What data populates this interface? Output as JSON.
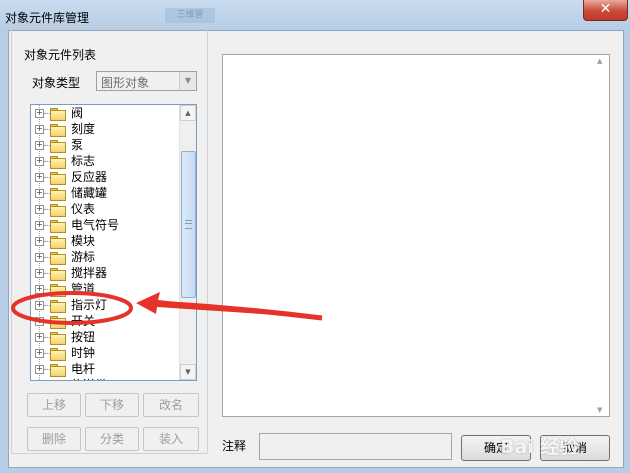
{
  "window": {
    "title": "对象元件库管理",
    "blurred_tab": "三维管",
    "close_glyph": "✕"
  },
  "group": {
    "legend": "对象元件列表"
  },
  "type_selector": {
    "label": "对象类型",
    "value": "图形对象"
  },
  "tree": {
    "items": [
      "阀",
      "刻度",
      "泵",
      "标志",
      "反应器",
      "储藏罐",
      "仪表",
      "电气符号",
      "模块",
      "游标",
      "搅拌器",
      "管道",
      "指示灯",
      "开关",
      "按钮",
      "时钟",
      "电杆",
      "传送带"
    ]
  },
  "buttons": {
    "move_up": "上移",
    "move_down": "下移",
    "rename": "改名",
    "delete": "删除",
    "classify": "分类",
    "load": "装入",
    "ok": "确定",
    "cancel": "取消"
  },
  "note": {
    "label": "注释",
    "value": ""
  },
  "watermark": "Bai 经验",
  "colors": {
    "annotation": "#e5332a",
    "titlebar": "#b7cde5",
    "close_button": "#c94b3a"
  }
}
